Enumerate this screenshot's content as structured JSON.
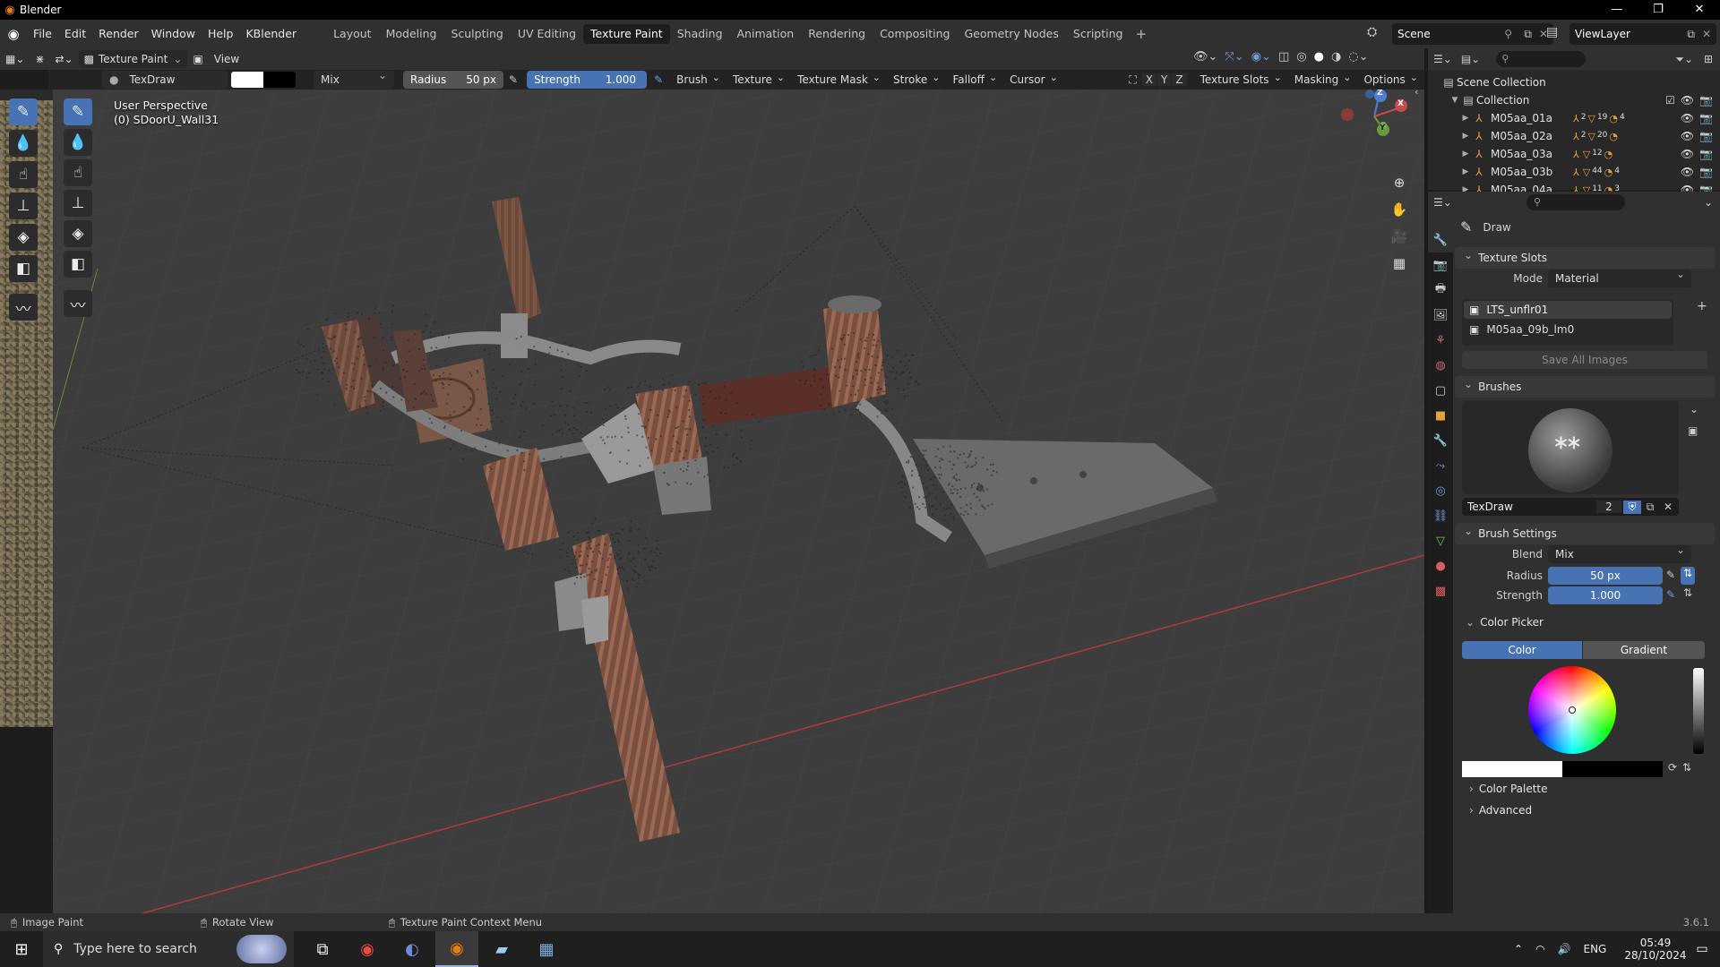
{
  "window": {
    "title": "Blender",
    "controls": [
      "—",
      "❐",
      "✕"
    ]
  },
  "menu": {
    "items": [
      "File",
      "Edit",
      "Render",
      "Window",
      "Help",
      "KBlender"
    ],
    "workspaces": [
      "Layout",
      "Modeling",
      "Sculpting",
      "UV Editing",
      "Texture Paint",
      "Shading",
      "Animation",
      "Rendering",
      "Compositing",
      "Geometry Nodes",
      "Scripting"
    ],
    "active_workspace": "Texture Paint",
    "scene": "Scene",
    "view_layer": "ViewLayer"
  },
  "header": {
    "mode": "Texture Paint",
    "view": "View"
  },
  "tool_settings": {
    "brush_name": "TexDraw",
    "blend": "Mix",
    "radius_label": "Radius",
    "radius_value": "50 px",
    "strength_label": "Strength",
    "strength_value": "1.000",
    "menus": [
      "Brush",
      "Texture",
      "Texture Mask",
      "Stroke",
      "Falloff",
      "Cursor"
    ],
    "axes": [
      "X",
      "Y",
      "Z"
    ],
    "right_menus": [
      "Texture Slots",
      "Masking",
      "Options"
    ]
  },
  "viewport": {
    "perspective": "User Perspective",
    "object": "(0) SDoorU_Wall31",
    "gizmo": {
      "x": "X",
      "y": "Y",
      "z": "Z"
    }
  },
  "outliner": {
    "root": "Scene Collection",
    "collection": "Collection",
    "objects": [
      {
        "name": "M05aa_01a",
        "a": "2",
        "b": "19",
        "c": "4"
      },
      {
        "name": "M05aa_02a",
        "a": "2",
        "b": "20",
        "c": ""
      },
      {
        "name": "M05aa_03a",
        "a": "",
        "b": "12",
        "c": ""
      },
      {
        "name": "M05aa_03b",
        "a": "",
        "b": "44",
        "c": "4"
      },
      {
        "name": "M05aa_04a",
        "a": "",
        "b": "11",
        "c": "3"
      }
    ]
  },
  "properties": {
    "tool_name": "Draw",
    "texture_slots": {
      "title": "Texture Slots",
      "mode_label": "Mode",
      "mode_value": "Material",
      "slots": [
        "LTS_unflr01",
        "M05aa_09b_lm0"
      ],
      "save_all": "Save All Images"
    },
    "brushes": {
      "title": "Brushes",
      "brush_name": "TexDraw",
      "users": "2"
    },
    "brush_settings": {
      "title": "Brush Settings",
      "blend_label": "Blend",
      "blend_value": "Mix",
      "radius_label": "Radius",
      "radius_value": "50 px",
      "strength_label": "Strength",
      "strength_value": "1.000"
    },
    "color_picker": {
      "title": "Color Picker",
      "tab_color": "Color",
      "tab_gradient": "Gradient"
    },
    "color_palette": "Color Palette",
    "advanced": "Advanced"
  },
  "statusbar": {
    "left": "Image Paint",
    "middle": "Rotate View",
    "right": "Texture Paint Context Menu",
    "version": "3.6.1"
  },
  "taskbar": {
    "search_placeholder": "Type here to search",
    "lang": "ENG",
    "time": "05:49",
    "date": "28/10/2024"
  },
  "colors": {
    "accent": "#4772b3",
    "panel": "#303030",
    "viewport": "#3d3d3d",
    "x_axis": "#b43a3a",
    "object_orange": "#e8a03c"
  }
}
